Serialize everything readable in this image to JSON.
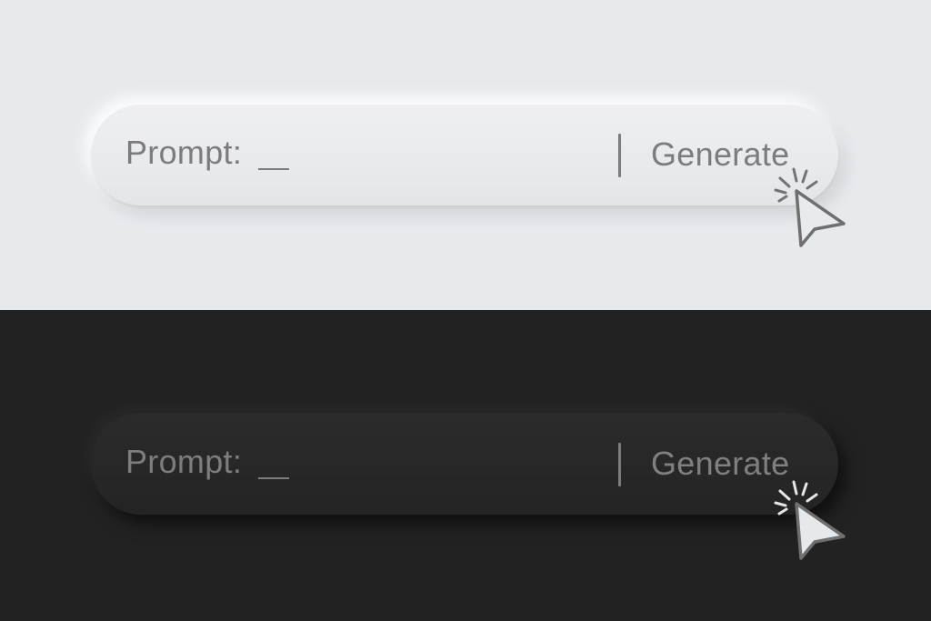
{
  "light_theme": {
    "prompt_label": "Prompt:",
    "generate_label": "Generate",
    "background_color": "#e6eaed",
    "text_color": "#7c7c7c"
  },
  "dark_theme": {
    "prompt_label": "Prompt:",
    "generate_label": "Generate",
    "background_color": "#222222",
    "text_color": "#7d7d7d"
  },
  "icons": {
    "pointer": "cursor-arrow-icon",
    "click_burst": "click-burst-icon"
  }
}
